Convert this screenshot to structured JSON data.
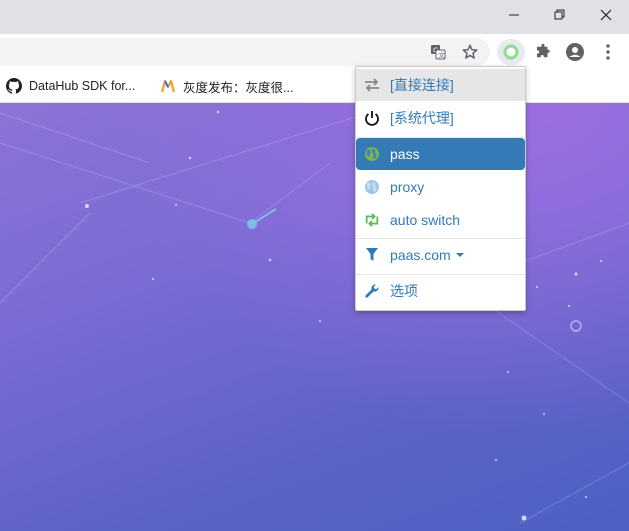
{
  "window": {
    "minimize_icon": "minimize-icon",
    "maximize_icon": "restore-icon",
    "close_icon": "close-icon"
  },
  "toolbar": {
    "icons": [
      "translate-icon",
      "star-icon",
      "proxy-extension-icon",
      "puzzle-icon",
      "account-icon",
      "more-vert-icon"
    ]
  },
  "bookmarks": [
    {
      "label": "DataHub SDK for...",
      "icon": "github-icon"
    },
    {
      "label": "灰度发布：灰度很...",
      "icon": "bookmark-logo-icon"
    }
  ],
  "menu": {
    "items": [
      {
        "label": "[直接连接]",
        "icon": "arrows-exchange-icon",
        "state": "hover"
      },
      {
        "label": "[系统代理]",
        "icon": "power-icon"
      },
      {
        "label": "pass",
        "icon": "globe-icon",
        "state": "selected"
      },
      {
        "label": "proxy",
        "icon": "globe-icon"
      },
      {
        "label": "auto switch",
        "icon": "retweet-icon"
      },
      {
        "label": "paas.com",
        "icon": "filter-icon",
        "dropdown": true
      },
      {
        "label": "选项",
        "icon": "wrench-icon"
      }
    ]
  },
  "colors": {
    "selected_bg": "#337ab7",
    "hover_bg": "#e6e6e6",
    "link": "#337ab7",
    "auto_switch_icon": "#5cb85c",
    "globe_light": "#9fc5e8"
  }
}
